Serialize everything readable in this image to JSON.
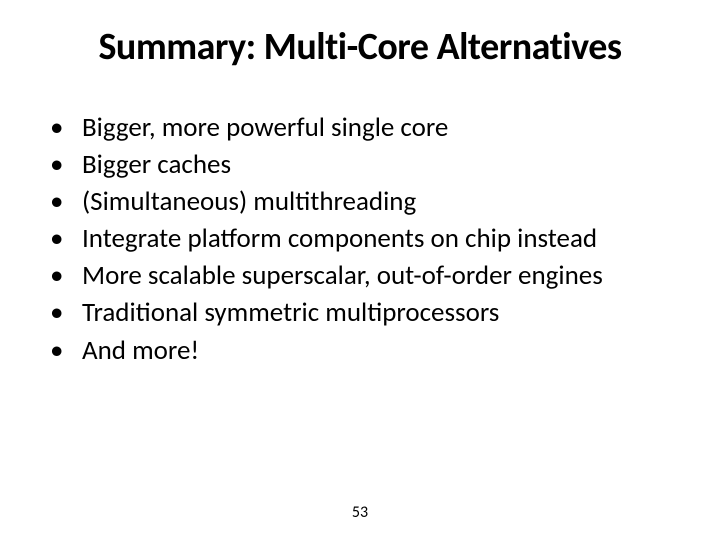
{
  "title": "Summary: Multi-Core Alternatives",
  "bullets": [
    "Bigger, more powerful single core",
    "Bigger caches",
    "(Simultaneous) multithreading",
    "Integrate platform components on chip instead",
    "More scalable superscalar, out-of-order engines",
    "Traditional symmetric multiprocessors",
    "And more!"
  ],
  "page_number": "53"
}
